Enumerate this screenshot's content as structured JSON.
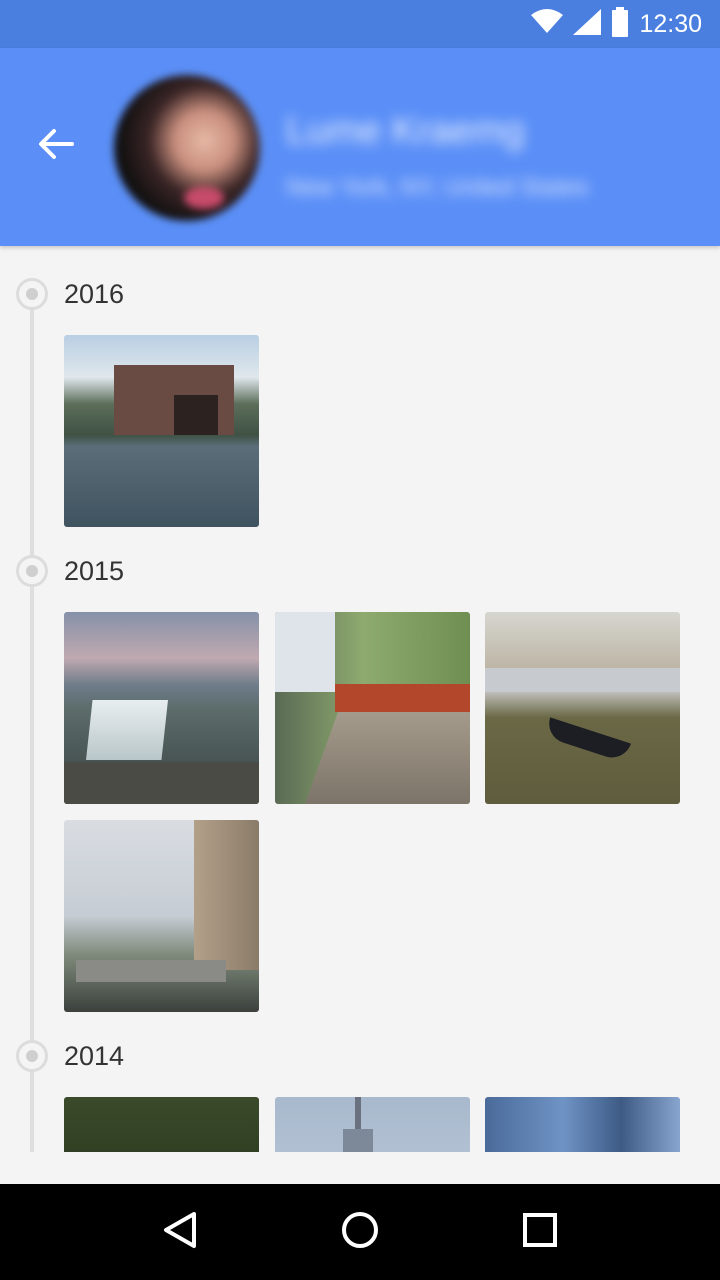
{
  "status_bar": {
    "time": "12:30",
    "icons": [
      "wifi-icon",
      "cell-signal-icon",
      "battery-icon"
    ]
  },
  "header": {
    "background_color": "#5b8ff7",
    "back_icon": "arrow-left-icon",
    "profile_name": "Lume Kraemg",
    "profile_location": "New York, NY, United States"
  },
  "timeline": {
    "years": [
      {
        "label": "2016",
        "photos": [
          "lakeside-castle-photo"
        ]
      },
      {
        "label": "2015",
        "photos": [
          "waterfall-photo",
          "promenade-photo",
          "gondola-canal-photo",
          "river-bridge-photo"
        ]
      },
      {
        "label": "2014",
        "photos": [
          "trees-sky-photo",
          "tower-spire-photo",
          "glass-skyscraper-photo"
        ]
      }
    ]
  },
  "nav_bar": {
    "icons": [
      "back-triangle-icon",
      "home-circle-icon",
      "recents-square-icon"
    ]
  }
}
